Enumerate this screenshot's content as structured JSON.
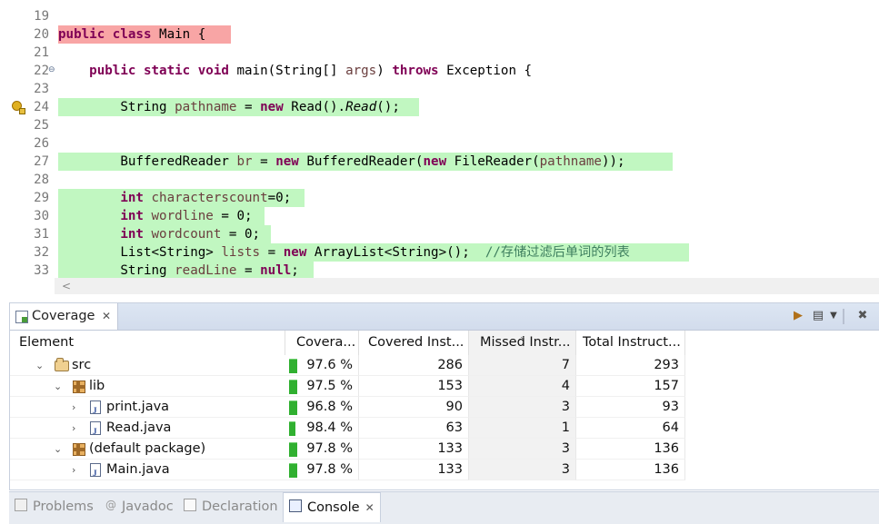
{
  "editor": {
    "lines": [
      {
        "num": "19",
        "type": "blank"
      },
      {
        "num": "20",
        "type": "class_decl",
        "kw1": "public",
        "kw2": "class",
        "rest": " Main {"
      },
      {
        "num": "21",
        "type": "blank"
      },
      {
        "num": "22",
        "type": "method_decl",
        "indent": "    ",
        "kw1": "public",
        "kw2": "static",
        "kw3": "void",
        "t1": " main(String[] ",
        "var1": "args",
        "t2": ") ",
        "kw4": "throws",
        "t3": " Exception {"
      },
      {
        "num": "23",
        "type": "blank"
      },
      {
        "num": "24",
        "type": "read",
        "indent": "        ",
        "t1": "String ",
        "var1": "pathname",
        "t2": " = ",
        "kw1": "new",
        "t3": " Read().",
        "it1": "Read",
        "t4": "();"
      },
      {
        "num": "25",
        "type": "blank"
      },
      {
        "num": "26",
        "type": "blank"
      },
      {
        "num": "27",
        "type": "br",
        "indent": "        ",
        "t1": "BufferedReader ",
        "var1": "br",
        "t2": " = ",
        "kw1": "new",
        "t3": " BufferedReader(",
        "kw2": "new",
        "t4": " FileReader(",
        "var2": "pathname",
        "t5": "));"
      },
      {
        "num": "28",
        "type": "blank"
      },
      {
        "num": "29",
        "type": "int",
        "indent": "        ",
        "kw1": "int",
        "sp": " ",
        "var1": "characterscount",
        "t1": "=0;"
      },
      {
        "num": "30",
        "type": "int",
        "indent": "        ",
        "kw1": "int",
        "sp": " ",
        "var1": "wordline",
        "t1": " = 0;"
      },
      {
        "num": "31",
        "type": "int",
        "indent": "        ",
        "kw1": "int",
        "sp": " ",
        "var1": "wordcount",
        "t1": " = 0;"
      },
      {
        "num": "32",
        "type": "list",
        "indent": "        ",
        "t1": "List<String> ",
        "var1": "lists",
        "t2": " = ",
        "kw1": "new",
        "t3": " ArrayList<String>();  ",
        "cm1": "//存储过滤后单词的列表"
      },
      {
        "num": "33",
        "type": "readline",
        "indent": "        ",
        "t1": "String ",
        "var1": "readLine",
        "t2": " = ",
        "kw1": "null",
        "t3": ";"
      }
    ]
  },
  "coverage": {
    "tab_label": "Coverage",
    "columns": [
      "Element",
      "Covera...",
      "Covered Inst...",
      "Missed Instr...",
      "Total Instruct..."
    ],
    "rows": [
      {
        "indent": 0,
        "icon": "source-folder-icon",
        "name": "src",
        "coverage": "97.6 %",
        "covered": "286",
        "missed": "7",
        "total": "293",
        "expanded": true
      },
      {
        "indent": 1,
        "icon": "package-icon",
        "name": "lib",
        "coverage": "97.5 %",
        "covered": "153",
        "missed": "4",
        "total": "157",
        "expanded": true
      },
      {
        "indent": 2,
        "icon": "java-file-icon",
        "name": "print.java",
        "coverage": "96.8 %",
        "covered": "90",
        "missed": "3",
        "total": "93",
        "expanded": false
      },
      {
        "indent": 2,
        "icon": "java-file-icon",
        "name": "Read.java",
        "coverage": "98.4 %",
        "covered": "63",
        "missed": "1",
        "total": "64",
        "expanded": false
      },
      {
        "indent": 1,
        "icon": "package-icon",
        "name": "(default package)",
        "coverage": "97.8 %",
        "covered": "133",
        "missed": "3",
        "total": "136",
        "expanded": true
      },
      {
        "indent": 2,
        "icon": "java-file-icon",
        "name": "Main.java",
        "coverage": "97.8 %",
        "covered": "133",
        "missed": "3",
        "total": "136",
        "expanded": false
      }
    ]
  },
  "bottom_tabs": [
    {
      "label": "Problems",
      "icon": "problems-icon",
      "active": false
    },
    {
      "label": "Javadoc",
      "icon": "javadoc-icon",
      "active": false
    },
    {
      "label": "Declaration",
      "icon": "declaration-icon",
      "active": false
    },
    {
      "label": "Console",
      "icon": "console-icon",
      "active": true
    }
  ]
}
